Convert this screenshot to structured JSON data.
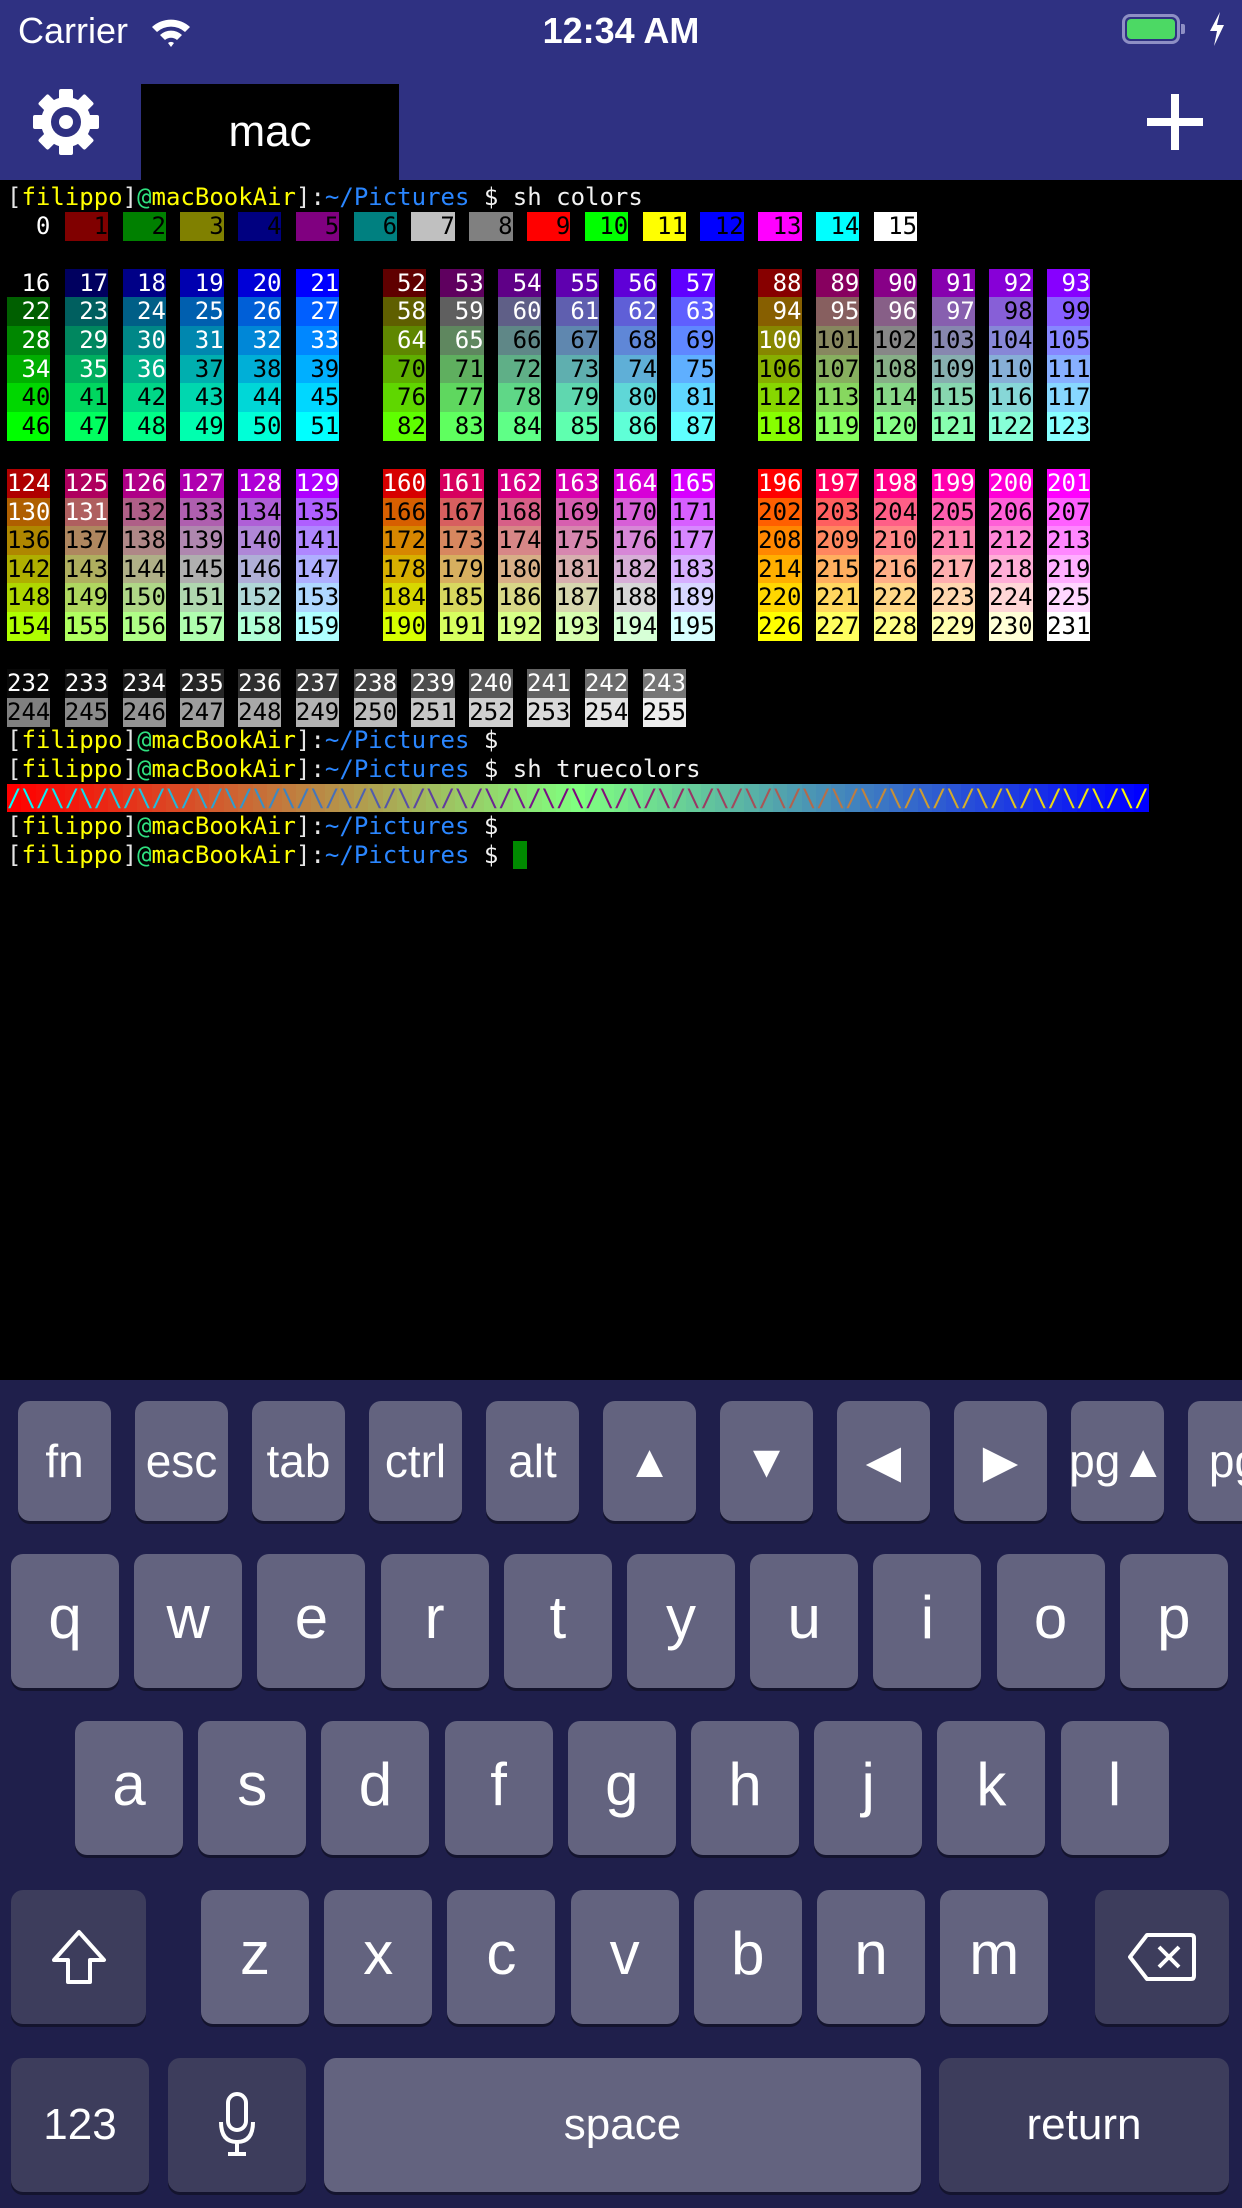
{
  "status_bar": {
    "carrier": "Carrier",
    "time": "12:34 AM",
    "battery_color": "#4cd964",
    "background": "#2f3182"
  },
  "nav": {
    "tab_label": "mac",
    "settings_icon": "gear-icon",
    "add_icon": "plus-icon"
  },
  "terminal": {
    "prompt": {
      "open": "[",
      "user": "filippo",
      "close": "]",
      "at": "@",
      "host": "macBookAir",
      "colon": ":",
      "path": "~/Pictures",
      "symbol": " $ "
    },
    "colors": {
      "user": "#ffff00",
      "at": "#2fe07f",
      "path": "#2a86ff",
      "cursor": "#008a00"
    },
    "ansi16": [
      "#000000",
      "#800000",
      "#008000",
      "#808000",
      "#000080",
      "#800080",
      "#008080",
      "#c0c0c0",
      "#808080",
      "#ff0000",
      "#00ff00",
      "#ffff00",
      "#0000ff",
      "#ff00ff",
      "#00ffff",
      "#ffffff"
    ],
    "lines": [
      {
        "type": "prompt",
        "command": "sh colors"
      },
      {
        "type": "colors",
        "groups": [
          [
            0,
            1,
            2,
            3,
            4,
            5,
            6,
            7,
            8,
            9,
            10,
            11,
            12,
            13,
            14,
            15
          ]
        ]
      },
      {
        "type": "blank"
      },
      {
        "type": "colors",
        "groups": [
          [
            16,
            17,
            18,
            19,
            20,
            21
          ],
          [
            52,
            53,
            54,
            55,
            56,
            57
          ],
          [
            88,
            89,
            90,
            91,
            92,
            93
          ]
        ]
      },
      {
        "type": "colors",
        "groups": [
          [
            22,
            23,
            24,
            25,
            26,
            27
          ],
          [
            58,
            59,
            60,
            61,
            62,
            63
          ],
          [
            94,
            95,
            96,
            97,
            98,
            99
          ]
        ]
      },
      {
        "type": "colors",
        "groups": [
          [
            28,
            29,
            30,
            31,
            32,
            33
          ],
          [
            64,
            65,
            66,
            67,
            68,
            69
          ],
          [
            100,
            101,
            102,
            103,
            104,
            105
          ]
        ]
      },
      {
        "type": "colors",
        "groups": [
          [
            34,
            35,
            36,
            37,
            38,
            39
          ],
          [
            70,
            71,
            72,
            73,
            74,
            75
          ],
          [
            106,
            107,
            108,
            109,
            110,
            111
          ]
        ]
      },
      {
        "type": "colors",
        "groups": [
          [
            40,
            41,
            42,
            43,
            44,
            45
          ],
          [
            76,
            77,
            78,
            79,
            80,
            81
          ],
          [
            112,
            113,
            114,
            115,
            116,
            117
          ]
        ]
      },
      {
        "type": "colors",
        "groups": [
          [
            46,
            47,
            48,
            49,
            50,
            51
          ],
          [
            82,
            83,
            84,
            85,
            86,
            87
          ],
          [
            118,
            119,
            120,
            121,
            122,
            123
          ]
        ]
      },
      {
        "type": "blank"
      },
      {
        "type": "colors",
        "groups": [
          [
            124,
            125,
            126,
            127,
            128,
            129
          ],
          [
            160,
            161,
            162,
            163,
            164,
            165
          ],
          [
            196,
            197,
            198,
            199,
            200,
            201
          ]
        ]
      },
      {
        "type": "colors",
        "groups": [
          [
            130,
            131,
            132,
            133,
            134,
            135
          ],
          [
            166,
            167,
            168,
            169,
            170,
            171
          ],
          [
            202,
            203,
            204,
            205,
            206,
            207
          ]
        ]
      },
      {
        "type": "colors",
        "groups": [
          [
            136,
            137,
            138,
            139,
            140,
            141
          ],
          [
            172,
            173,
            174,
            175,
            176,
            177
          ],
          [
            208,
            209,
            210,
            211,
            212,
            213
          ]
        ]
      },
      {
        "type": "colors",
        "groups": [
          [
            142,
            143,
            144,
            145,
            146,
            147
          ],
          [
            178,
            179,
            180,
            181,
            182,
            183
          ],
          [
            214,
            215,
            216,
            217,
            218,
            219
          ]
        ]
      },
      {
        "type": "colors",
        "groups": [
          [
            148,
            149,
            150,
            151,
            152,
            153
          ],
          [
            184,
            185,
            186,
            187,
            188,
            189
          ],
          [
            220,
            221,
            222,
            223,
            224,
            225
          ]
        ]
      },
      {
        "type": "colors",
        "groups": [
          [
            154,
            155,
            156,
            157,
            158,
            159
          ],
          [
            190,
            191,
            192,
            193,
            194,
            195
          ],
          [
            226,
            227,
            228,
            229,
            230,
            231
          ]
        ]
      },
      {
        "type": "blank"
      },
      {
        "type": "colors",
        "groups": [
          [
            232,
            233,
            234,
            235,
            236,
            237,
            238,
            239,
            240,
            241,
            242,
            243
          ]
        ]
      },
      {
        "type": "colors",
        "groups": [
          [
            244,
            245,
            246,
            247,
            248,
            249,
            250,
            251,
            252,
            253,
            254,
            255
          ]
        ]
      },
      {
        "type": "prompt",
        "command": ""
      },
      {
        "type": "prompt",
        "command": "sh truecolors"
      },
      {
        "type": "gradient",
        "text": "/\\/\\/\\/\\/\\/\\/\\/\\/\\/\\/\\/\\/\\/\\/\\/\\/\\/\\/\\/\\/\\/\\/\\/\\/\\/\\/\\/\\/\\/\\/\\/\\/\\/\\/\\/\\/\\/\\/\\/"
      },
      {
        "type": "prompt",
        "command": ""
      },
      {
        "type": "prompt",
        "command": "",
        "cursor": true
      }
    ]
  },
  "keyboard": {
    "accessory": [
      "fn",
      "esc",
      "tab",
      "ctrl",
      "alt",
      "▲",
      "▼",
      "◀",
      "▶",
      "pg▲",
      "pg"
    ],
    "row1": [
      "q",
      "w",
      "e",
      "r",
      "t",
      "y",
      "u",
      "i",
      "o",
      "p"
    ],
    "row2": [
      "a",
      "s",
      "d",
      "f",
      "g",
      "h",
      "j",
      "k",
      "l"
    ],
    "row3": [
      "z",
      "x",
      "c",
      "v",
      "b",
      "n",
      "m"
    ],
    "shift_icon": "shift-arrow-icon",
    "delete_icon": "backspace-icon",
    "numbers_label": "123",
    "mic_icon": "microphone-icon",
    "space_label": "space",
    "return_label": "return",
    "key_color": "#63637f",
    "dark_key_color": "#3d3d5c",
    "background": "#1f1f4b"
  }
}
